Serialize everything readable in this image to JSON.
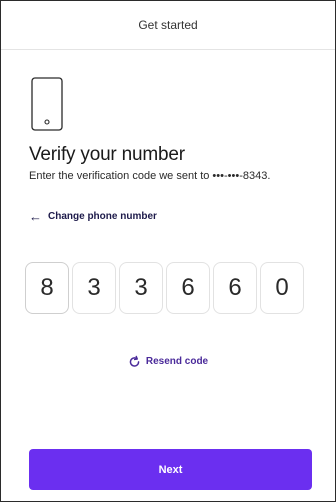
{
  "header": {
    "title": "Get started"
  },
  "verify": {
    "title": "Verify your number",
    "description": "Enter the verification code we sent to •••-•••-8343.",
    "change_link": "Change phone number"
  },
  "code": {
    "digits": [
      "8",
      "3",
      "3",
      "6",
      "6",
      "0"
    ]
  },
  "resend": {
    "label": "Resend code"
  },
  "next": {
    "label": "Next"
  },
  "colors": {
    "accent": "#6b2ff0",
    "link_dark": "#1d1a4a",
    "link_purple": "#4a2a9a"
  },
  "icons": {
    "phone": "phone-icon",
    "back": "arrow-left-icon",
    "resend": "refresh-icon"
  }
}
